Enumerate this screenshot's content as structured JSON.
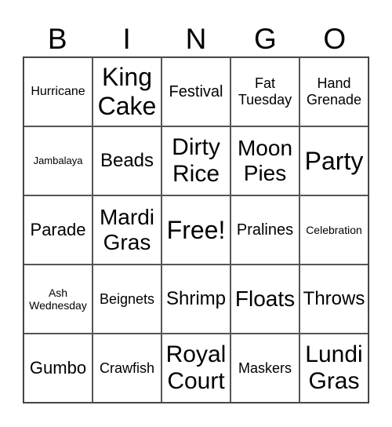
{
  "header": [
    "B",
    "I",
    "N",
    "G",
    "O"
  ],
  "cells": [
    [
      "Hurricane",
      "King Cake",
      "Festival",
      "Fat Tuesday",
      "Hand Grenade"
    ],
    [
      "Jambalaya",
      "Beads",
      "Dirty Rice",
      "Moon Pies",
      "Party"
    ],
    [
      "Parade",
      "Mardi Gras",
      "Free!",
      "Pralines",
      "Celebration"
    ],
    [
      "Ash Wednesday",
      "Beignets",
      "Shrimp",
      "Floats",
      "Throws"
    ],
    [
      "Gumbo",
      "Crawfish",
      "Royal Court",
      "Maskers",
      "Lundi Gras"
    ]
  ]
}
